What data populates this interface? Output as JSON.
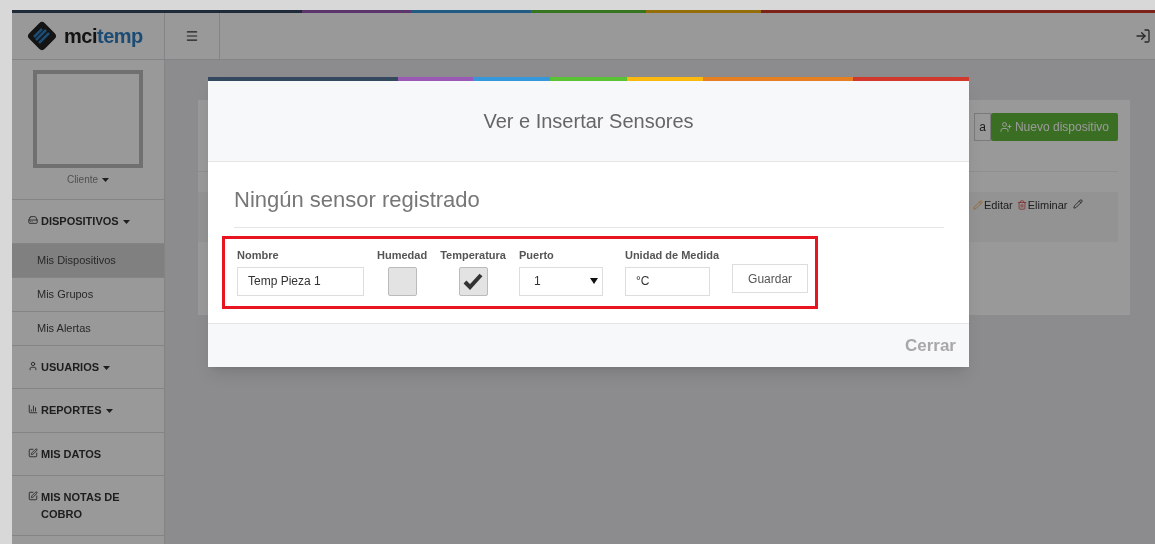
{
  "app": {
    "logo_prefix": "mci",
    "logo_suffix": "temp"
  },
  "profile": {
    "name": "Cliente"
  },
  "sidebar": {
    "items": [
      {
        "kind": "section",
        "label": "DISPOSITIVOS",
        "children": [
          {
            "label": "Mis Dispositivos",
            "selected": true
          },
          {
            "label": "Mis Grupos",
            "selected": false
          },
          {
            "label": "Mis Alertas",
            "selected": false
          }
        ]
      },
      {
        "kind": "section",
        "label": "USUARIOS"
      },
      {
        "kind": "section",
        "label": "REPORTES"
      },
      {
        "kind": "link",
        "label": "MIS DATOS"
      },
      {
        "kind": "link",
        "label": "MIS NOTAS DE COBRO"
      }
    ]
  },
  "background": {
    "partial_button": "a",
    "new_button": "Nuevo dispositivo",
    "actions": [
      "Editar",
      "Eliminar"
    ]
  },
  "modal": {
    "title": "Ver e Insertar Sensores",
    "message": "Ningún sensor registrado",
    "form": {
      "name_label": "Nombre",
      "name_value": "Temp Pieza 1",
      "checks": [
        {
          "label": "Humedad",
          "checked": false
        },
        {
          "label": "Temperatura",
          "checked": true
        }
      ],
      "port_label": "Puerto",
      "port_value": "1",
      "unit_label": "Unidad de Medida",
      "unit_value": "°C",
      "save": "Guardar"
    },
    "close": "Cerrar"
  }
}
